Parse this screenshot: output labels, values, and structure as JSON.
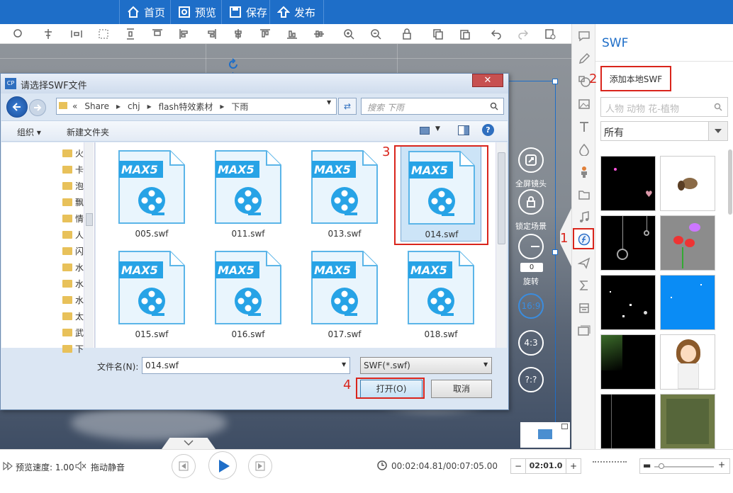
{
  "topbar": {
    "home": "首页",
    "preview": "预览",
    "save": "保存",
    "publish": "发布"
  },
  "canvas_controls": {
    "fullscreen": "全屏镜头",
    "lock_scene": "锁定场景",
    "rotate": "旋转",
    "rotate_value": "0",
    "ratio_169": "16:9",
    "ratio_43": "4:3",
    "ratio_custom": "?:?"
  },
  "panel": {
    "title": "SWF",
    "add_local": "添加本地SWF",
    "search_placeholder": "人物 动物 花-植物",
    "category": "所有"
  },
  "dialog": {
    "title": "请选择SWF文件",
    "breadcrumb": [
      "«",
      "Share",
      "chj",
      "flash特效素材",
      "下雨"
    ],
    "search_placeholder": "搜索 下雨",
    "organize": "组织 ▾",
    "new_folder": "新建文件夹",
    "tree": [
      "火",
      "卡",
      "泡",
      "飘",
      "情",
      "人",
      "闪",
      "水",
      "水",
      "水",
      "太",
      "武",
      "下"
    ],
    "files": [
      "005.swf",
      "011.swf",
      "013.swf",
      "014.swf",
      "015.swf",
      "016.swf",
      "017.swf",
      "018.swf"
    ],
    "file_badge": "MAX5",
    "filename_label": "文件名(N):",
    "filename_value": "014.swf",
    "filter": "SWF(*.swf)",
    "open": "打开(O)",
    "cancel": "取消"
  },
  "annotations": [
    "1",
    "2",
    "3",
    "4"
  ],
  "status": {
    "speed": "预览速度: 1.00",
    "drag_mute": "拖动静音",
    "time": "00:02:04.81/00:07:05.00",
    "duration": "02:01.0"
  },
  "colors": {
    "brand": "#1e6ec8",
    "highlight": "#d9251c"
  }
}
